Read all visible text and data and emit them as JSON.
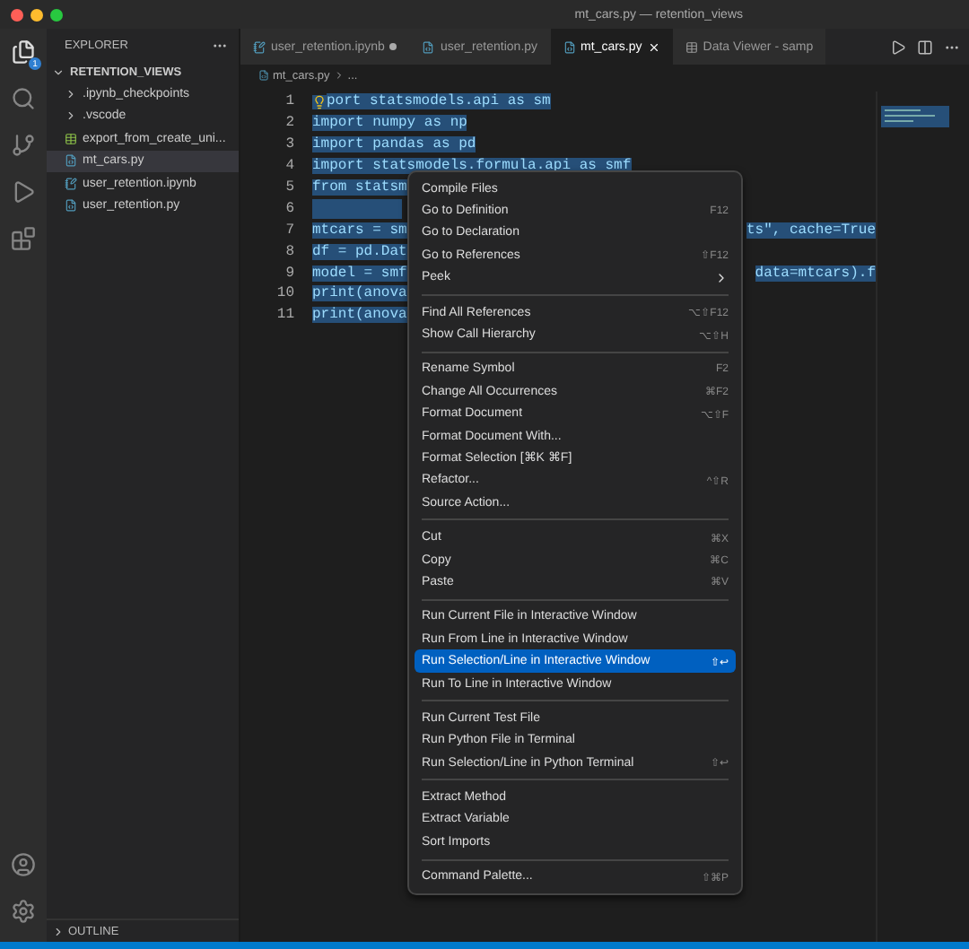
{
  "window": {
    "title": "mt_cars.py — retention_views"
  },
  "activity_bar": {
    "explorer_badge": "1"
  },
  "sidebar": {
    "title": "EXPLORER",
    "folder": {
      "name": "RETENTION_VIEWS",
      "expanded": true,
      "children": [
        {
          "name": ".ipynb_checkpoints",
          "kind": "folder",
          "expanded": false,
          "selected": false
        },
        {
          "name": ".vscode",
          "kind": "folder",
          "expanded": false,
          "selected": false
        },
        {
          "name": "export_from_create_uni...",
          "kind": "table",
          "selected": false
        },
        {
          "name": "mt_cars.py",
          "kind": "python",
          "selected": true
        },
        {
          "name": "user_retention.ipynb",
          "kind": "notebook",
          "selected": false
        },
        {
          "name": "user_retention.py",
          "kind": "python",
          "selected": false
        }
      ]
    },
    "outline": {
      "title": "OUTLINE",
      "expanded": false
    }
  },
  "tabs": [
    {
      "label": "user_retention.ipynb",
      "kind": "notebook",
      "selected": false,
      "modified": true
    },
    {
      "label": "user_retention.py",
      "kind": "python",
      "selected": false,
      "modified": false
    },
    {
      "label": "mt_cars.py",
      "kind": "python",
      "selected": true,
      "modified": false
    },
    {
      "label": "Data Viewer - samp",
      "kind": "viewer",
      "selected": false,
      "modified": false
    }
  ],
  "breadcrumb": [
    "mt_cars.py",
    "..."
  ],
  "code_lines": [
    {
      "number": "1",
      "text": "port statsmodels.api as sm",
      "lightbulb": true,
      "selected": true
    },
    {
      "number": "2",
      "text": "import numpy as np",
      "selected": true
    },
    {
      "number": "3",
      "text": "import pandas as pd",
      "selected": true
    },
    {
      "number": "4",
      "text": "import statsmodels.formula.api as smf",
      "selected": true
    },
    {
      "number": "5",
      "text": "from statsm",
      "selected": true
    },
    {
      "number": "6",
      "selected": true
    },
    {
      "number": "7",
      "text": "mtcars = sm",
      "tail": "ts\", cache=True",
      "selected": true
    },
    {
      "number": "8",
      "text": "df = pd.Dat",
      "selected": true
    },
    {
      "number": "9",
      "text": "model = smf",
      "tail": "data=mtcars).f",
      "selected": true
    },
    {
      "number": "10",
      "text": "print(anova",
      "selected": true
    },
    {
      "number": "11",
      "text": "print(anova",
      "selected": true
    }
  ],
  "context_menu": {
    "groups": [
      [
        {
          "label": "Compile Files",
          "selected": false
        },
        {
          "label": "Go to Definition",
          "shortcut": "F12",
          "selected": false
        },
        {
          "label": "Go to Declaration",
          "selected": false
        },
        {
          "label": "Go to References",
          "shortcut": "⇧F12",
          "selected": false
        },
        {
          "label": "Peek",
          "submenu": true,
          "selected": false
        }
      ],
      [
        {
          "label": "Find All References",
          "shortcut": "⌥⇧F12",
          "selected": false
        },
        {
          "label": "Show Call Hierarchy",
          "shortcut": "⌥⇧H",
          "selected": false
        }
      ],
      [
        {
          "label": "Rename Symbol",
          "shortcut": "F2",
          "selected": false
        },
        {
          "label": "Change All Occurrences",
          "shortcut": "⌘F2",
          "selected": false
        },
        {
          "label": "Format Document",
          "shortcut": "⌥⇧F",
          "selected": false
        },
        {
          "label": "Format Document With...",
          "selected": false
        },
        {
          "label": "Format Selection [⌘K ⌘F]",
          "selected": false
        },
        {
          "label": "Refactor...",
          "shortcut": "^⇧R",
          "selected": false
        },
        {
          "label": "Source Action...",
          "selected": false
        }
      ],
      [
        {
          "label": "Cut",
          "shortcut": "⌘X",
          "selected": false
        },
        {
          "label": "Copy",
          "shortcut": "⌘C",
          "selected": false
        },
        {
          "label": "Paste",
          "shortcut": "⌘V",
          "selected": false
        }
      ],
      [
        {
          "label": "Run Current File in Interactive Window",
          "selected": false
        },
        {
          "label": "Run From Line in Interactive Window",
          "selected": false
        },
        {
          "label": "Run Selection/Line in Interactive Window",
          "shortcut": "⇧↩",
          "selected": true
        },
        {
          "label": "Run To Line in Interactive Window",
          "selected": false
        }
      ],
      [
        {
          "label": "Run Current Test File",
          "selected": false
        },
        {
          "label": "Run Python File in Terminal",
          "selected": false
        },
        {
          "label": "Run Selection/Line in Python Terminal",
          "shortcut": "⇧↩",
          "selected": false
        }
      ],
      [
        {
          "label": "Extract Method",
          "selected": false
        },
        {
          "label": "Extract Variable",
          "selected": false
        },
        {
          "label": "Sort Imports",
          "selected": false
        }
      ],
      [
        {
          "label": "Command Palette...",
          "shortcut": "⇧⌘P",
          "selected": false
        }
      ]
    ]
  }
}
